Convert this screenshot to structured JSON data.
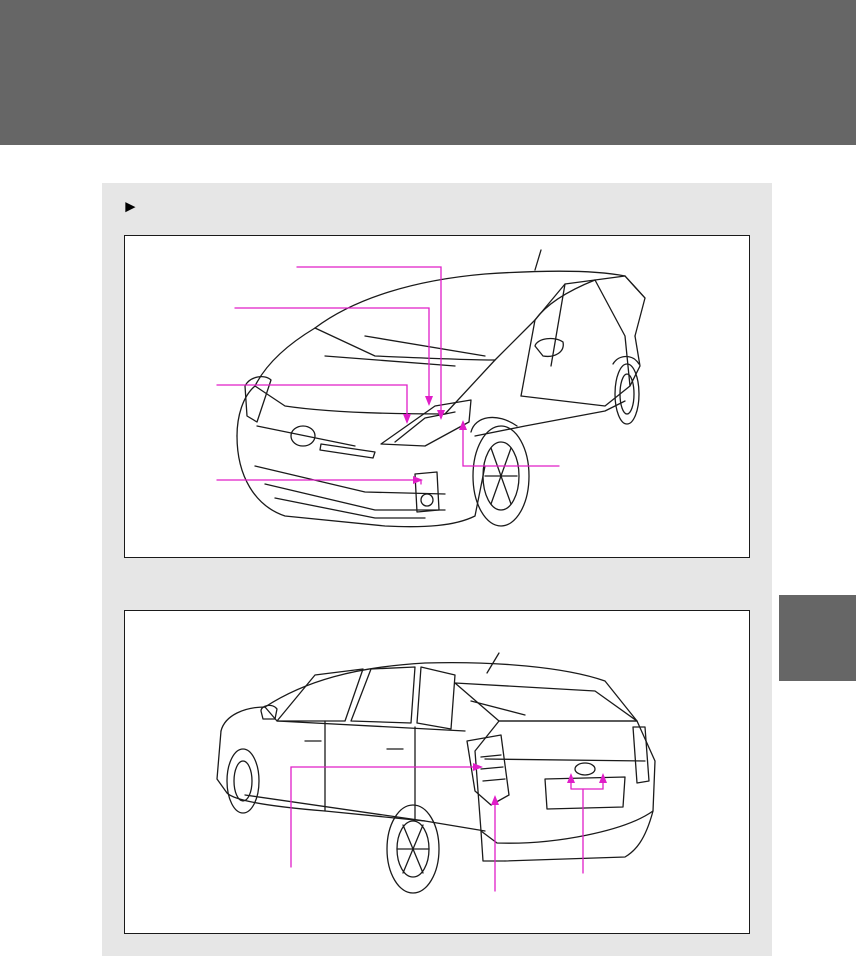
{
  "page": {
    "header_text": "",
    "side_tab_text": ""
  },
  "section": {
    "marker_glyph": "►"
  },
  "figures": {
    "front": {
      "name": "front-view-illustration"
    },
    "rear": {
      "name": "rear-view-illustration"
    }
  },
  "colors": {
    "band": "#666666",
    "panel": "#e6e6e6",
    "callout": "#e01ec8",
    "line_art": "#1a1a1a"
  }
}
